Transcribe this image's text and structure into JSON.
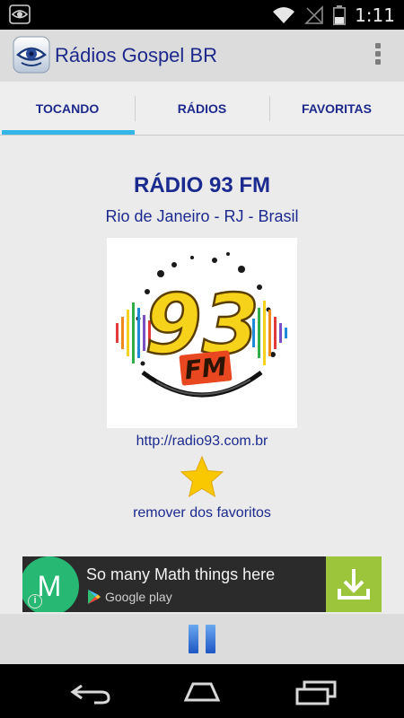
{
  "status_bar": {
    "time": "1:11",
    "icons": [
      "eye-notification-icon",
      "wifi-icon",
      "no-signal-icon",
      "battery-icon"
    ]
  },
  "app_bar": {
    "title": "Rádios Gospel BR",
    "icon": "eye-app-icon",
    "menu_icon": "overflow-menu-icon"
  },
  "tabs": [
    {
      "label": "TOCANDO",
      "active": true
    },
    {
      "label": "RÁDIOS",
      "active": false
    },
    {
      "label": "FAVORITAS",
      "active": false
    }
  ],
  "station": {
    "name": "RÁDIO 93 FM",
    "location": "Rio de Janeiro - RJ - Brasil",
    "logo_text": "93",
    "logo_subtext": "FM",
    "url": "http://radio93.com.br",
    "favorite_label": "remover dos favoritos",
    "is_favorite": true
  },
  "ad": {
    "app_letter": "M",
    "headline": "So many Math things here",
    "store_label": "Google play",
    "info_label": "i"
  },
  "player": {
    "state": "playing",
    "control_icon": "pause-icon"
  },
  "nav_bar": {
    "icons": [
      "back-icon",
      "home-icon",
      "recent-apps-icon"
    ]
  },
  "colors": {
    "accent_tab": "#33b5e5",
    "text_primary": "#1a2a8e",
    "star": "#f9c800",
    "ad_icon": "#27b874",
    "ad_download": "#9cc53c",
    "pause": "#2a6ad6"
  }
}
